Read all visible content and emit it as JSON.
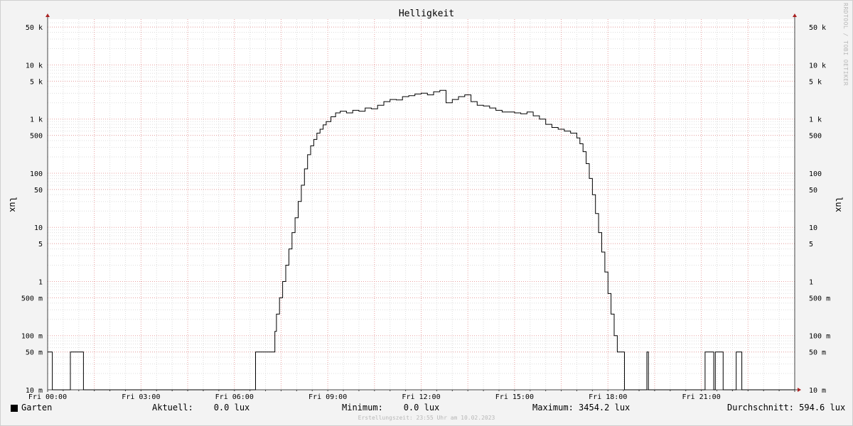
{
  "chart_data": {
    "type": "line",
    "title": "Helligkeit",
    "ylabel": "lux",
    "yscale": "log",
    "ylim": [
      0.01,
      70000
    ],
    "xlim": [
      0,
      24
    ],
    "grid": true,
    "x_ticks": [
      {
        "x": 0,
        "label": "Fri 00:00"
      },
      {
        "x": 3,
        "label": "Fri 03:00"
      },
      {
        "x": 6,
        "label": "Fri 06:00"
      },
      {
        "x": 9,
        "label": "Fri 09:00"
      },
      {
        "x": 12,
        "label": "Fri 12:00"
      },
      {
        "x": 15,
        "label": "Fri 15:00"
      },
      {
        "x": 18,
        "label": "Fri 18:00"
      },
      {
        "x": 21,
        "label": "Fri 21:00"
      }
    ],
    "y_ticks": [
      {
        "v": 50000,
        "label": "50 k"
      },
      {
        "v": 10000,
        "label": "10 k"
      },
      {
        "v": 5000,
        "label": "5 k"
      },
      {
        "v": 1000,
        "label": "1 k"
      },
      {
        "v": 500,
        "label": "500"
      },
      {
        "v": 100,
        "label": "100"
      },
      {
        "v": 50,
        "label": "50"
      },
      {
        "v": 10,
        "label": "10"
      },
      {
        "v": 5,
        "label": "5"
      },
      {
        "v": 1,
        "label": "1"
      },
      {
        "v": 0.5,
        "label": "500 m"
      },
      {
        "v": 0.1,
        "label": "100 m"
      },
      {
        "v": 0.05,
        "label": "50 m"
      },
      {
        "v": 0.01,
        "label": "10 m"
      }
    ],
    "series": [
      {
        "name": "Garten",
        "color": "#000000",
        "x": [
          0,
          0.12,
          0.15,
          0.7,
          0.73,
          1.1,
          1.15,
          6.65,
          6.68,
          7.25,
          7.3,
          7.35,
          7.45,
          7.55,
          7.65,
          7.75,
          7.85,
          7.95,
          8.05,
          8.15,
          8.25,
          8.35,
          8.45,
          8.55,
          8.65,
          8.75,
          8.85,
          8.95,
          9.1,
          9.25,
          9.4,
          9.6,
          9.8,
          10.0,
          10.2,
          10.4,
          10.6,
          10.8,
          11.0,
          11.2,
          11.4,
          11.6,
          11.8,
          12.0,
          12.2,
          12.4,
          12.6,
          12.8,
          13.0,
          13.2,
          13.4,
          13.6,
          13.8,
          14.0,
          14.2,
          14.4,
          14.6,
          14.8,
          15.0,
          15.2,
          15.4,
          15.6,
          15.8,
          16.0,
          16.2,
          16.4,
          16.6,
          16.8,
          17.0,
          17.1,
          17.2,
          17.3,
          17.4,
          17.5,
          17.6,
          17.7,
          17.8,
          17.9,
          18.0,
          18.1,
          18.2,
          18.3,
          18.35,
          18.45,
          18.5,
          18.53,
          19.2,
          19.25,
          19.3,
          21.1,
          21.12,
          21.35,
          21.4,
          21.45,
          21.65,
          21.7,
          22.1,
          22.12,
          22.25,
          22.3,
          24.0
        ],
        "y": [
          0.05,
          0.05,
          0.01,
          0.01,
          0.05,
          0.05,
          0.01,
          0.01,
          0.05,
          0.05,
          0.12,
          0.25,
          0.5,
          1.0,
          2.0,
          4.0,
          8.0,
          15.0,
          30.0,
          60.0,
          120.0,
          220.0,
          320.0,
          420.0,
          550.0,
          650.0,
          780.0,
          900.0,
          1100.0,
          1300.0,
          1400.0,
          1300.0,
          1450.0,
          1400.0,
          1600.0,
          1550.0,
          1800.0,
          2100.0,
          2300.0,
          2250.0,
          2600.0,
          2700.0,
          2900.0,
          3000.0,
          2800.0,
          3200.0,
          3400.0,
          2000.0,
          2300.0,
          2600.0,
          2800.0,
          2100.0,
          1800.0,
          1750.0,
          1600.0,
          1450.0,
          1350.0,
          1350.0,
          1300.0,
          1250.0,
          1350.0,
          1150.0,
          1000.0,
          800.0,
          700.0,
          650.0,
          600.0,
          550.0,
          450.0,
          350.0,
          250.0,
          150.0,
          80.0,
          40.0,
          18.0,
          8.0,
          3.5,
          1.5,
          0.6,
          0.25,
          0.1,
          0.05,
          0.05,
          0.05,
          0.05,
          0.01,
          0.01,
          0.05,
          0.01,
          0.01,
          0.05,
          0.05,
          0.01,
          0.05,
          0.05,
          0.01,
          0.01,
          0.05,
          0.05,
          0.01,
          0.01
        ]
      }
    ]
  },
  "legend": {
    "series_name": "Garten",
    "current": "Aktuell:    0.0 lux",
    "minimum": "Minimum:    0.0 lux",
    "maximum": "Maximum: 3454.2 lux",
    "average": "Durchschnitt: 594.6 lux"
  },
  "footer": "Erstellungszeit: 23:55 Uhr am 10.02.2023",
  "watermark": "RRDTOOL / TOBI OETIKER",
  "colors": {
    "background": "#f3f3f3",
    "plot_background": "#ffffff",
    "grid_minor": "#dddddd",
    "grid_major": "#e8a0a0",
    "axis": "#444444",
    "arrow": "#aa2222",
    "line": "#000000"
  }
}
